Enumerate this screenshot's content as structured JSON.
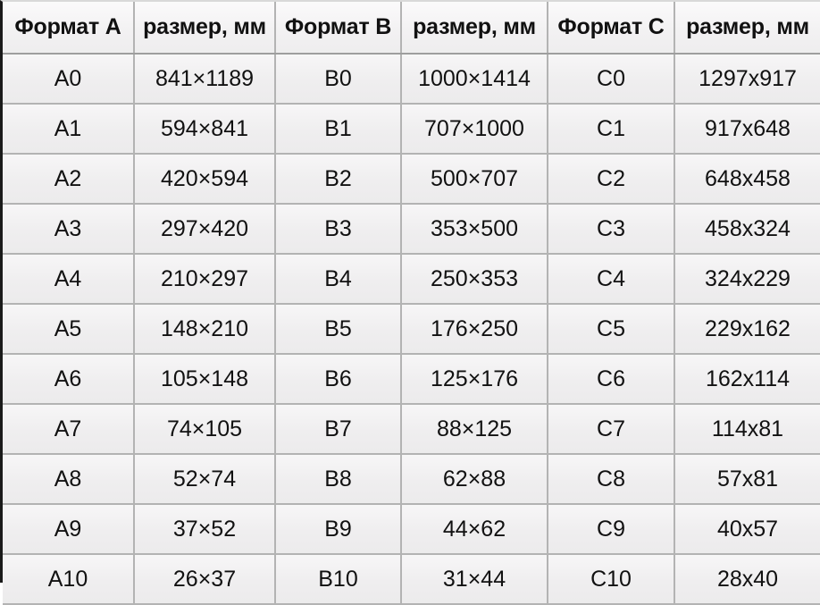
{
  "table": {
    "headers": [
      "Формат A",
      "размер, мм",
      "Формат B",
      "размер, мм",
      "Формат C",
      "размер, мм"
    ],
    "rows": [
      [
        "A0",
        "841×1189",
        "B0",
        "1000×1414",
        "C0",
        "1297x917"
      ],
      [
        "A1",
        "594×841",
        "B1",
        "707×1000",
        "C1",
        "917x648"
      ],
      [
        "A2",
        "420×594",
        "B2",
        "500×707",
        "C2",
        "648x458"
      ],
      [
        "A3",
        "297×420",
        "B3",
        "353×500",
        "C3",
        "458x324"
      ],
      [
        "A4",
        "210×297",
        "B4",
        "250×353",
        "C4",
        "324x229"
      ],
      [
        "A5",
        "148×210",
        "B5",
        "176×250",
        "C5",
        "229x162"
      ],
      [
        "A6",
        "105×148",
        "B6",
        "125×176",
        "C6",
        "162x114"
      ],
      [
        "A7",
        "74×105",
        "B7",
        "88×125",
        "C7",
        "114x81"
      ],
      [
        "A8",
        "52×74",
        "B8",
        "62×88",
        "C8",
        "57x81"
      ],
      [
        "A9",
        "37×52",
        "B9",
        "44×62",
        "C9",
        "40x57"
      ],
      [
        "A10",
        "26×37",
        "B10",
        "31×44",
        "C10",
        "28x40"
      ]
    ],
    "colors": {
      "cell_background": "#efeeef",
      "header_background": "#f2f1f2",
      "grid_line": "#b3b3b3",
      "outer_border": "#1a1a1a",
      "text": "#111111"
    }
  }
}
